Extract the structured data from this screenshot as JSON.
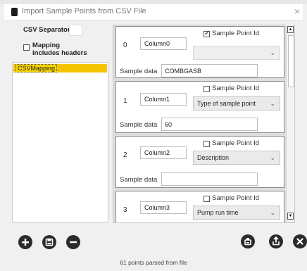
{
  "window": {
    "title": "Import Sample Points from CSV File",
    "close_glyph": "×"
  },
  "left": {
    "csv_separator_label": "CSV Separator:",
    "csv_separator_value": "",
    "headers_label_line1": "Mapping",
    "headers_label_line2": "includes headers",
    "headers_checked": false,
    "mappings": [
      "CSVMapping"
    ]
  },
  "columns": [
    {
      "index": "0",
      "name": "Column0",
      "sample_point_id_label": "Sample Point Id",
      "sample_point_id_checked": true,
      "type": "",
      "sample_data_label": "Sample data",
      "sample_data": "COMBGASB"
    },
    {
      "index": "1",
      "name": "Column1",
      "sample_point_id_label": "Sample Point Id",
      "sample_point_id_checked": false,
      "type": "Type of sample point",
      "sample_data_label": "Sample data",
      "sample_data": "60"
    },
    {
      "index": "2",
      "name": "Column2",
      "sample_point_id_label": "Sample Point Id",
      "sample_point_id_checked": false,
      "type": "Description",
      "sample_data_label": "Sample data",
      "sample_data": ""
    },
    {
      "index": "3",
      "name": "Column3",
      "sample_point_id_label": "Sample Point Id",
      "sample_point_id_checked": false,
      "type": "Pump run time",
      "sample_data_label": "Sample data",
      "sample_data": ""
    }
  ],
  "toolbar": {
    "left_icons": [
      "add-icon",
      "save-icon",
      "remove-icon"
    ],
    "right_icons": [
      "export-icon",
      "import-icon",
      "close-icon"
    ]
  },
  "status": {
    "text": "61 points parsed from file"
  },
  "colors": {
    "selection": "#f5c400",
    "icon": "#2b2b2b"
  }
}
